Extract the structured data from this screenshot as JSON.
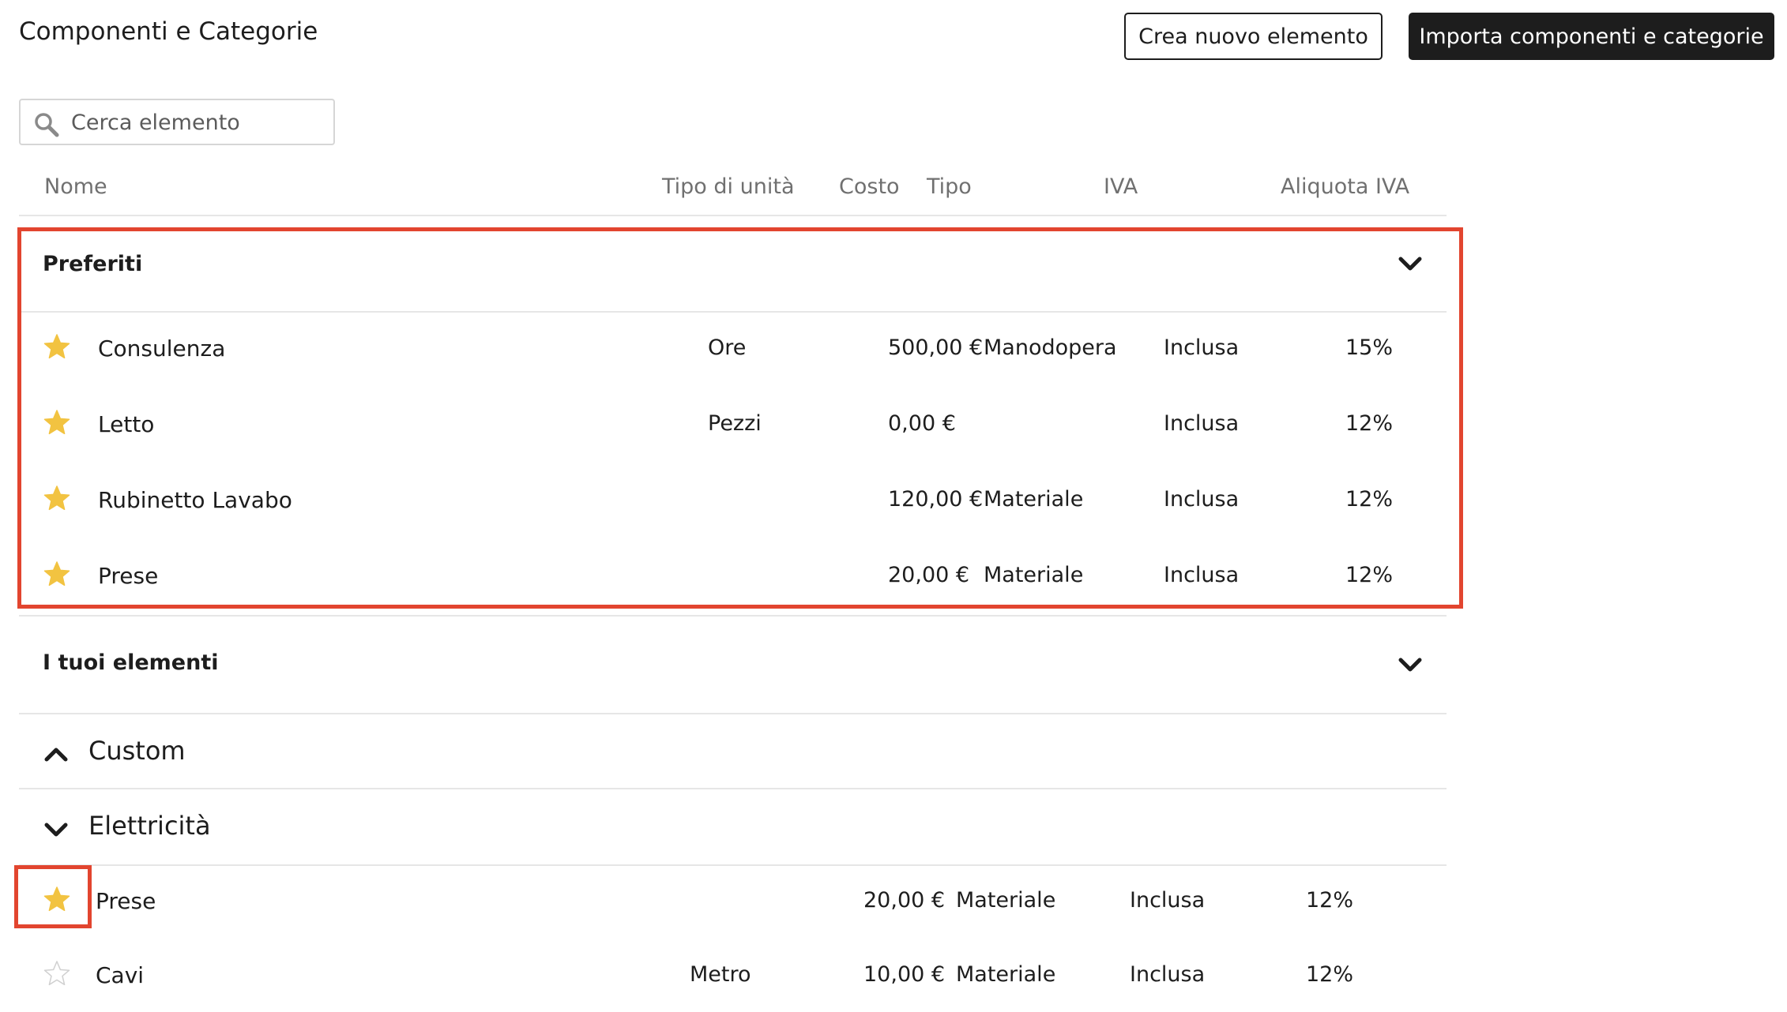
{
  "header": {
    "title": "Componenti e Categorie",
    "create_label": "Crea nuovo elemento",
    "import_label": "Importa componenti e categorie"
  },
  "search": {
    "placeholder": "Cerca elemento",
    "value": ""
  },
  "table": {
    "columns": {
      "name": "Nome",
      "unit_type": "Tipo di unità",
      "cost": "Costo",
      "type": "Tipo",
      "vat": "IVA",
      "vat_rate": "Aliquota IVA"
    }
  },
  "favorites": {
    "title": "Preferiti",
    "rows": [
      {
        "starred": true,
        "name": "Consulenza",
        "unit": "Ore",
        "cost": "500,00 €",
        "type": "Manodopera",
        "vat": "Inclusa",
        "rate": "15%"
      },
      {
        "starred": true,
        "name": "Letto",
        "unit": "Pezzi",
        "cost": "0,00 €",
        "type": "",
        "vat": "Inclusa",
        "rate": "12%"
      },
      {
        "starred": true,
        "name": "Rubinetto Lavabo",
        "unit": "",
        "cost": "120,00 €",
        "type": "Materiale",
        "vat": "Inclusa",
        "rate": "12%"
      },
      {
        "starred": true,
        "name": "Prese",
        "unit": "",
        "cost": "20,00 €",
        "type": "Materiale",
        "vat": "Inclusa",
        "rate": "12%"
      }
    ]
  },
  "your_items": {
    "title": "I tuoi elementi"
  },
  "categories": [
    {
      "title": "Custom",
      "expanded": false
    },
    {
      "title": "Elettricità",
      "expanded": true,
      "rows": [
        {
          "starred": true,
          "name": "Prese",
          "unit": "",
          "cost": "20,00 €",
          "type": "Materiale",
          "vat": "Inclusa",
          "rate": "12%"
        },
        {
          "starred": false,
          "name": "Cavi",
          "unit": "Metro",
          "cost": "10,00 €",
          "type": "Materiale",
          "vat": "Inclusa",
          "rate": "12%"
        }
      ]
    }
  ],
  "colors": {
    "accent_dark": "#1d1d1d",
    "star_filled": "#f2c341",
    "highlight_frame": "#e2452f"
  }
}
